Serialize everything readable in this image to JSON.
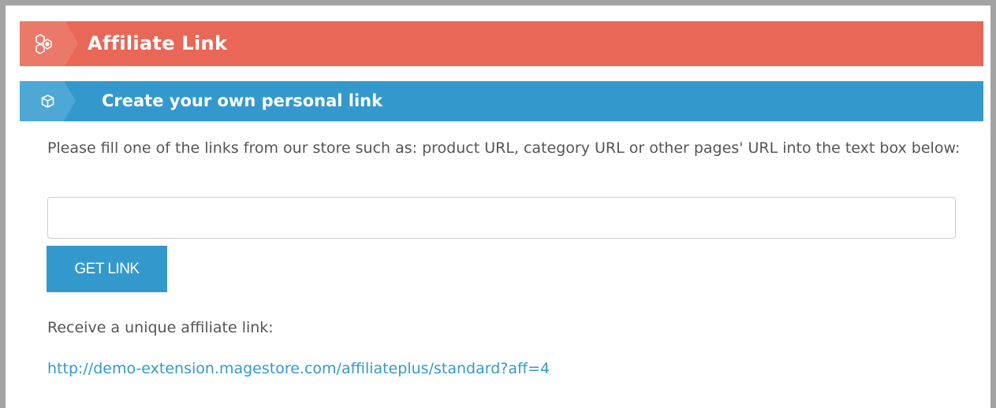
{
  "panel": {
    "title": "Affiliate Link",
    "title_icon": "hexagon-cluster-icon",
    "accent_color": "#e96757"
  },
  "section": {
    "title": "Create your own personal link",
    "icon": "cube-icon",
    "accent_color": "#3399cc",
    "instructions": "Please fill one of the links from our store such as: product URL, category URL or other pages' URL into the text box below:",
    "url_input": {
      "value": "",
      "placeholder": ""
    },
    "button_label": "GET LINK",
    "receive_label": "Receive a unique affiliate link:",
    "affiliate_url": "http://demo-extension.magestore.com/affiliateplus/standard?aff=4"
  }
}
